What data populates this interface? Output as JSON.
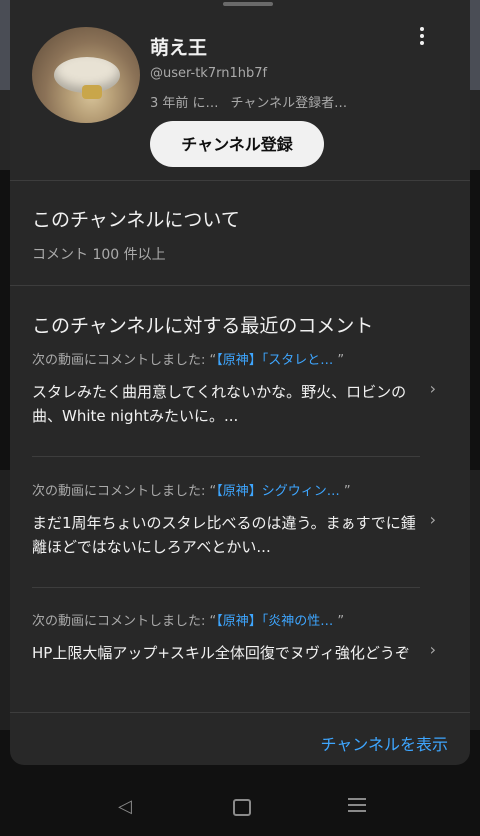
{
  "profile": {
    "name": "萌え王",
    "handle": "@user-tk7rn1hb7f",
    "joined": "3 年前 に…",
    "subscribers": "チャンネル登録者…",
    "subscribe_label": "チャンネル登録"
  },
  "about": {
    "title": "このチャンネルについて",
    "comment_count": "コメント 100 件以上"
  },
  "recent": {
    "title": "このチャンネルに対する最近のコメント",
    "items": [
      {
        "prefix": "次の動画にコメントしました: “",
        "video": "【原神】「スタレと…",
        "suffix": " ”",
        "text": "スタレみたく曲用意してくれないかな。野火、ロビンの曲、White nightみたいに。..."
      },
      {
        "prefix": "次の動画にコメントしました: “",
        "video": "【原神】シグウィン…",
        "suffix": " ”",
        "text": "まだ1周年ちょいのスタレ比べるのは違う。まぁすでに鍾離ほどではないにしろアベとかい..."
      },
      {
        "prefix": "次の動画にコメントしました: “",
        "video": "【原神】「炎神の性…",
        "suffix": " ”",
        "text": "HP上限大幅アップ+スキル全体回復でヌヴィ強化どうぞ"
      }
    ]
  },
  "footer": {
    "view_channel": "チャンネルを表示"
  },
  "colors": {
    "sheet_bg": "#282828",
    "accent_link": "#3ea6ff",
    "subscribe_bg": "#f1f1f1"
  }
}
